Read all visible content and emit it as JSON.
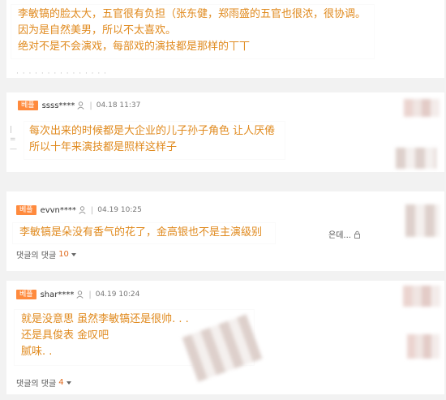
{
  "top": {
    "lines": [
      "李敏镐的脸太大，五官很有负担（张东健，郑雨盛的五官也很浓，很协调。",
      "因为是自然美男，所以不太喜欢。",
      "绝对不是不会演戏，每部戏的演技都是那样的丅丅"
    ]
  },
  "comments": [
    {
      "badge": "베플",
      "user": "ssss****",
      "time": "04.18 11:37",
      "lines": [
        "每次出来的时候都是大企业的儿子孙子角色  让人厌倦",
        "所以十年来演技都是照样这样子"
      ]
    },
    {
      "badge": "베플",
      "user": "evvn****",
      "time": "04.19 10:25",
      "lines": [
        "李敏镐是朵没有香气的花了，金高银也不是主演级别"
      ],
      "trailing": "은데...",
      "replies_label": "댓글의 댓글",
      "replies_count": "10"
    },
    {
      "badge": "베플",
      "user": "shar****",
      "time": "04.19 10:24",
      "lines": [
        "就是没意思  虽然李敏镐还是很帅. . .",
        "还是具俊表  金叹吧",
        "腻味. ."
      ],
      "replies_label": "댓글의 댓글",
      "replies_count": "4"
    }
  ],
  "colors": {
    "highlight_text": "#e08a1e",
    "badge_bg": "#ff8a3d"
  }
}
